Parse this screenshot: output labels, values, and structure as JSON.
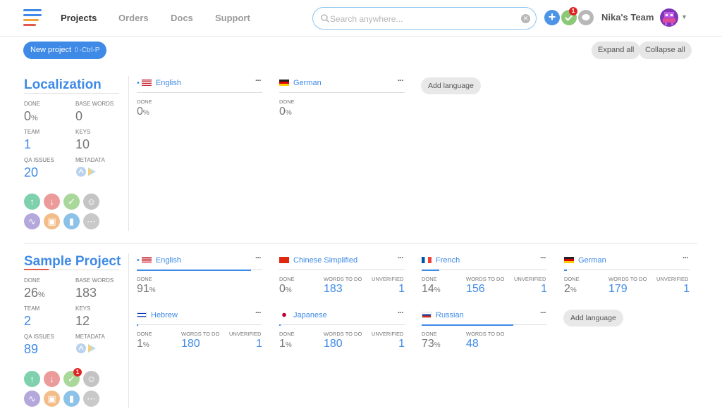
{
  "nav": {
    "links": [
      "Projects",
      "Orders",
      "Docs",
      "Support"
    ],
    "search_placeholder": "Search anywhere...",
    "notification_count": "1",
    "team_name": "Nika's Team"
  },
  "toolbar": {
    "new_project": "New project",
    "new_project_hint": "⇧-Ctrl-P",
    "expand_all": "Expand all",
    "collapse_all": "Collapse all"
  },
  "colors": {
    "accent": "#3e8ae6",
    "brand_logo": [
      "#3e8ae6",
      "#f2a33a",
      "#e25a4a"
    ]
  },
  "projects": [
    {
      "name": "Localization",
      "stats": {
        "done_label": "DONE",
        "done": "0",
        "done_unit": "%",
        "base_words_label": "BASE WORDS",
        "base_words": "0",
        "team_label": "TEAM",
        "team": "1",
        "keys_label": "KEYS",
        "keys": "10",
        "qa_label": "QA ISSUES",
        "qa": "20",
        "metadata_label": "METADATA"
      },
      "languages": [
        {
          "name": "English",
          "flag": "us",
          "dot": true,
          "done_label": "DONE",
          "done": "0",
          "done_unit": "%"
        },
        {
          "name": "German",
          "flag": "de",
          "dot": false,
          "done_label": "DONE",
          "done": "0",
          "done_unit": "%"
        }
      ],
      "add_language": "Add language",
      "action_badge": ""
    },
    {
      "name": "Sample Project",
      "stats": {
        "done_label": "DONE",
        "done": "26",
        "done_unit": "%",
        "base_words_label": "BASE WORDS",
        "base_words": "183",
        "team_label": "TEAM",
        "team": "2",
        "keys_label": "KEYS",
        "keys": "12",
        "qa_label": "QA ISSUES",
        "qa": "89",
        "metadata_label": "METADATA"
      },
      "languages": [
        {
          "name": "English",
          "flag": "us",
          "dot": true,
          "done_label": "DONE",
          "done": "91",
          "done_unit": "%",
          "progress": 0.91
        },
        {
          "name": "Chinese Simplified",
          "flag": "cn",
          "dot": false,
          "done_label": "DONE",
          "done": "0",
          "done_unit": "%",
          "todo_label": "WORDS TO DO",
          "todo": "183",
          "unv_label": "UNVERIFIED",
          "unv": "1",
          "progress": 0
        },
        {
          "name": "French",
          "flag": "fr",
          "dot": false,
          "done_label": "DONE",
          "done": "14",
          "done_unit": "%",
          "todo_label": "WORDS TO DO",
          "todo": "156",
          "unv_label": "UNVERIFIED",
          "unv": "1",
          "progress": 0.14
        },
        {
          "name": "German",
          "flag": "de",
          "dot": false,
          "done_label": "DONE",
          "done": "2",
          "done_unit": "%",
          "todo_label": "WORDS TO DO",
          "todo": "179",
          "unv_label": "UNVERIFIED",
          "unv": "1",
          "progress": 0.02
        },
        {
          "name": "Hebrew",
          "flag": "il",
          "dot": false,
          "done_label": "DONE",
          "done": "1",
          "done_unit": "%",
          "todo_label": "WORDS TO DO",
          "todo": "180",
          "unv_label": "UNVERIFIED",
          "unv": "1",
          "progress": 0.01
        },
        {
          "name": "Japanese",
          "flag": "jp",
          "dot": false,
          "done_label": "DONE",
          "done": "1",
          "done_unit": "%",
          "todo_label": "WORDS TO DO",
          "todo": "180",
          "unv_label": "UNVERIFIED",
          "unv": "1",
          "progress": 0.01
        },
        {
          "name": "Russian",
          "flag": "ru",
          "dot": false,
          "done_label": "DONE",
          "done": "73",
          "done_unit": "%",
          "todo_label": "WORDS TO DO",
          "todo": "48",
          "progress": 0.73
        }
      ],
      "add_language": "Add language",
      "action_badge": "1"
    }
  ]
}
